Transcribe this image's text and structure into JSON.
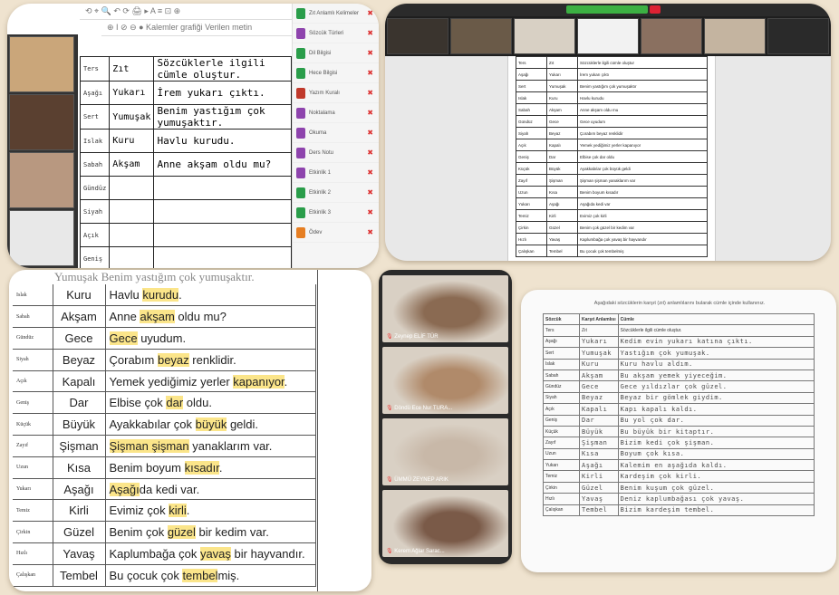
{
  "tile1": {
    "toolbar_row1": "⟲ ⌖ 🔍  ↶ ⟳ 🖨  ▸  A  ≡  ⊡  ⊕",
    "toolbar_row2": "⊕  I  ⊘  ⊖  ●  Kalemler grafiği   Verilen metin",
    "rows": [
      {
        "key": "Ters",
        "word": "Zıt",
        "sentence": "Sözcüklerle ilgili cümle oluştur."
      },
      {
        "key": "Aşağı",
        "word": "Yukarı",
        "sentence": "İrem yukarı çıktı."
      },
      {
        "key": "Sert",
        "word": "Yumuşak",
        "sentence": "Benim yastığım çok yumuşaktır."
      },
      {
        "key": "Islak",
        "word": "Kuru",
        "sentence": "Havlu kurudu."
      },
      {
        "key": "Sabah",
        "word": "Akşam",
        "sentence": "Anne akşam oldu mu?"
      },
      {
        "key": "Gündüz",
        "word": "",
        "sentence": ""
      },
      {
        "key": "Siyah",
        "word": "",
        "sentence": ""
      },
      {
        "key": "Açık",
        "word": "",
        "sentence": ""
      },
      {
        "key": "Geniş",
        "word": "",
        "sentence": ""
      }
    ],
    "side_items": [
      {
        "label": "Zıt Anlamlı Kelimeler",
        "color": "#2a9d4a"
      },
      {
        "label": "Sözcük Türleri",
        "color": "#8e44ad"
      },
      {
        "label": "Dil Bilgisi",
        "color": "#2a9d4a"
      },
      {
        "label": "Hece Bilgisi",
        "color": "#2a9d4a"
      },
      {
        "label": "Yazım Kuralı",
        "color": "#c0392b"
      },
      {
        "label": "Noktalama",
        "color": "#8e44ad"
      },
      {
        "label": "Okuma",
        "color": "#8e44ad"
      },
      {
        "label": "Ders Notu",
        "color": "#8e44ad"
      },
      {
        "label": "Etkinlik 1",
        "color": "#8e44ad"
      },
      {
        "label": "Etkinlik 2",
        "color": "#2a9d4a"
      },
      {
        "label": "Etkinlik 3",
        "color": "#2a9d4a"
      },
      {
        "label": "Ödev",
        "color": "#e67e22"
      }
    ]
  },
  "tile2": {
    "rows": [
      [
        "Ters",
        "Zıt",
        "Sözcüklerle ilgili cümle oluştur"
      ],
      [
        "Aşağı",
        "Yukarı",
        "İrem yukarı çıktı"
      ],
      [
        "Sert",
        "Yumuşak",
        "Benim yastığım çok yumuşaktır"
      ],
      [
        "Islak",
        "Kuru",
        "Havlu kurudu"
      ],
      [
        "Sabah",
        "Akşam",
        "Anne akşam oldu mu"
      ],
      [
        "Gündüz",
        "Gece",
        "Gece uyudum"
      ],
      [
        "Siyah",
        "Beyaz",
        "Çorabım beyaz renklidir"
      ],
      [
        "Açık",
        "Kapalı",
        "Yemek yediğimiz yerler kapanıyor"
      ],
      [
        "Geniş",
        "Dar",
        "Elbise çok dar oldu"
      ],
      [
        "Küçük",
        "Büyük",
        "Ayakkabılar çok büyük geldi"
      ],
      [
        "Zayıf",
        "Şişman",
        "Şişman şişman yanaklarım var"
      ],
      [
        "Uzun",
        "Kısa",
        "Benim boyum kısadır"
      ],
      [
        "Yukarı",
        "Aşağı",
        "Aşağıda kedi var"
      ],
      [
        "Temiz",
        "Kirli",
        "Evimiz çok kirli"
      ],
      [
        "Çirkin",
        "Güzel",
        "Benim çok güzel bir kedim var"
      ],
      [
        "Hızlı",
        "Yavaş",
        "Kaplumbağa çok yavaş bir hayvandır"
      ],
      [
        "Çalışkan",
        "Tembel",
        "Bu çocuk çok tembelmiş"
      ]
    ]
  },
  "tile3": {
    "top_partial": "Yumuşak   Benim yastığım çok yumuşaktır.",
    "rows": [
      {
        "key": "Islak",
        "word": "Kuru",
        "pre": "Havlu ",
        "hl": "kurudu",
        "post": "."
      },
      {
        "key": "Sabah",
        "word": "Akşam",
        "pre": "Anne ",
        "hl": "akşam",
        "post": " oldu mu?"
      },
      {
        "key": "Gündüz",
        "word": "Gece",
        "pre": "",
        "hl": "Gece",
        "post": " uyudum."
      },
      {
        "key": "Siyah",
        "word": "Beyaz",
        "pre": "Çorabım ",
        "hl": "beyaz",
        "post": " renklidir."
      },
      {
        "key": "Açık",
        "word": "Kapalı",
        "pre": "Yemek yediğimiz yerler ",
        "hl": "kapanıyor",
        "post": "."
      },
      {
        "key": "Geniş",
        "word": "Dar",
        "pre": "Elbise çok ",
        "hl": "dar",
        "post": " oldu."
      },
      {
        "key": "Küçük",
        "word": "Büyük",
        "pre": "Ayakkabılar çok ",
        "hl": "büyük",
        "post": " geldi."
      },
      {
        "key": "Zayıf",
        "word": "Şişman",
        "pre": "",
        "hl": "Şişman şişman",
        "post": " yanaklarım var."
      },
      {
        "key": "Uzun",
        "word": "Kısa",
        "pre": "Benim boyum ",
        "hl": "kısadır",
        "post": "."
      },
      {
        "key": "Yukarı",
        "word": "Aşağı",
        "pre": "",
        "hl": "Aşağı",
        "post": "da kedi var."
      },
      {
        "key": "Temiz",
        "word": "Kirli",
        "pre": "Evimiz çok ",
        "hl": "kirli",
        "post": "."
      },
      {
        "key": "Çirkin",
        "word": "Güzel",
        "pre": "Benim çok ",
        "hl": "güzel",
        "post": " bir kedim var."
      },
      {
        "key": "Hızlı",
        "word": "Yavaş",
        "pre": "Kaplumbağa çok ",
        "hl": "yavaş",
        "post": " bir hayvandır."
      },
      {
        "key": "Çalışkan",
        "word": "Tembel",
        "pre": "Bu çocuk çok ",
        "hl": "tembel",
        "post": "miş."
      }
    ]
  },
  "tile4": {
    "participants": [
      {
        "name": "Zeynep ELİF TÜR",
        "bg": "#8a6a52"
      },
      {
        "name": "Döndü Ece Nur TURA...",
        "bg": "#b08a6a"
      },
      {
        "name": "ÜMMÜ ZEYNEP ARIK",
        "bg": "#c8b8a8"
      },
      {
        "name": "Kerem Ağlar Sarac...",
        "bg": "#7a5a48"
      }
    ]
  },
  "tile5": {
    "title": "Aşağıdaki sözcüklerin karşıt (zıt) anlamlılarını bularak cümle içinde kullanınız.",
    "header": [
      "Sözcük",
      "Karşıt Anlamlısı",
      "Cümle"
    ],
    "rows": [
      [
        "Ters",
        "Zıt",
        "Sözcüklerle ilgili cümle oluştur."
      ],
      [
        "Aşağı",
        "Yukarı",
        "Kedim evin yukarı katına çıktı."
      ],
      [
        "Sert",
        "Yumuşak",
        "Yastığım çok yumuşak."
      ],
      [
        "Islak",
        "Kuru",
        "Kuru havlu aldım."
      ],
      [
        "Sabah",
        "Akşam",
        "Bu akşam yemek yiyeceğim."
      ],
      [
        "Gündüz",
        "Gece",
        "Gece yıldızlar çok güzel."
      ],
      [
        "Siyah",
        "Beyaz",
        "Beyaz bir gömlek giydim."
      ],
      [
        "Açık",
        "Kapalı",
        "Kapı kapalı kaldı."
      ],
      [
        "Geniş",
        "Dar",
        "Bu yol çok dar."
      ],
      [
        "Küçük",
        "Büyük",
        "Bu büyük bir kitaptır."
      ],
      [
        "Zayıf",
        "Şişman",
        "Bizim kedi çok şişman."
      ],
      [
        "Uzun",
        "Kısa",
        "Boyum çok kısa."
      ],
      [
        "Yukarı",
        "Aşağı",
        "Kalemim en aşağıda kaldı."
      ],
      [
        "Temiz",
        "Kirli",
        "Kardeşim çok kirli."
      ],
      [
        "Çirkin",
        "Güzel",
        "Benim kuşum çok güzel."
      ],
      [
        "Hızlı",
        "Yavaş",
        "Deniz kaplumbağası çok yavaş."
      ],
      [
        "Çalışkan",
        "Tembel",
        "Bizim kardeşim tembel."
      ]
    ]
  }
}
